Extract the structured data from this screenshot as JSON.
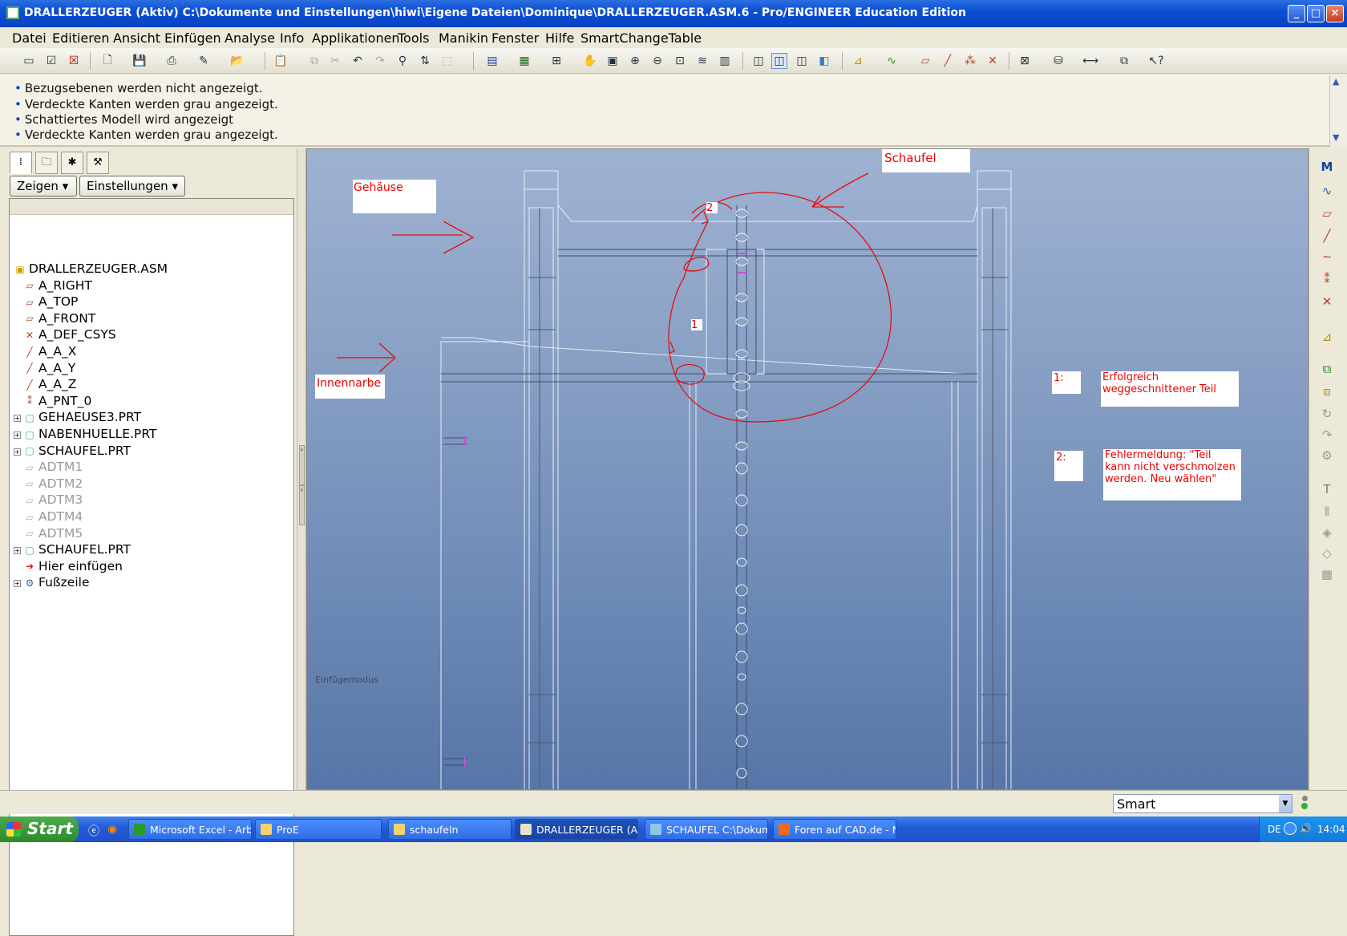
{
  "window": {
    "title": "DRALLERZEUGER (Aktiv) C:\\Dokumente und Einstellungen\\hiwi\\Eigene Dateien\\Dominique\\DRALLERZEUGER.ASM.6 - Pro/ENGINEER Education Edition",
    "minimize": "_",
    "maximize": "□",
    "close": "×"
  },
  "menu": [
    "Datei",
    "Editieren",
    "Ansicht",
    "Einfügen",
    "Analyse",
    "Info",
    "Applikationen",
    "Tools",
    "Manikin",
    "Fenster",
    "Hilfe",
    "SmartChangeTable"
  ],
  "messages": [
    "Bezugsebenen werden nicht angezeigt.",
    "Verdeckte Kanten werden grau angezeigt.",
    "Schattiertes Modell wird angezeigt",
    "Verdeckte Kanten werden grau angezeigt."
  ],
  "leftpanel": {
    "show_label": "Zeigen",
    "settings_label": "Einstellungen",
    "tree": [
      {
        "label": "DRALLERZEUGER.ASM",
        "icon": "assembly-icon",
        "disabled": false
      },
      {
        "label": "A_RIGHT",
        "icon": "datum-plane-icon",
        "disabled": false
      },
      {
        "label": "A_TOP",
        "icon": "datum-plane-icon",
        "disabled": false
      },
      {
        "label": "A_FRONT",
        "icon": "datum-plane-icon",
        "disabled": false
      },
      {
        "label": "A_DEF_CSYS",
        "icon": "csys-icon",
        "disabled": false
      },
      {
        "label": "A_A_X",
        "icon": "axis-icon",
        "disabled": false
      },
      {
        "label": "A_A_Y",
        "icon": "axis-icon",
        "disabled": false
      },
      {
        "label": "A_A_Z",
        "icon": "axis-icon",
        "disabled": false
      },
      {
        "label": "A_PNT_0",
        "icon": "point-icon",
        "disabled": false
      },
      {
        "label": "GEHAEUSE3.PRT",
        "icon": "part-icon",
        "disabled": false
      },
      {
        "label": "NABENHUELLE.PRT",
        "icon": "part-icon",
        "disabled": false
      },
      {
        "label": "SCHAUFEL.PRT",
        "icon": "part-icon",
        "disabled": false
      },
      {
        "label": "ADTM1",
        "icon": "datum-plane-icon",
        "disabled": true
      },
      {
        "label": "ADTM2",
        "icon": "datum-plane-icon",
        "disabled": true
      },
      {
        "label": "ADTM3",
        "icon": "datum-plane-icon",
        "disabled": true
      },
      {
        "label": "ADTM4",
        "icon": "datum-plane-icon",
        "disabled": true
      },
      {
        "label": "ADTM5",
        "icon": "datum-plane-icon",
        "disabled": true
      },
      {
        "label": "SCHAUFEL.PRT",
        "icon": "part-icon",
        "disabled": false
      },
      {
        "label": "Hier einfügen",
        "icon": "insert-arrow-icon",
        "disabled": false
      },
      {
        "label": "Fußzeile",
        "icon": "footer-icon",
        "disabled": false
      }
    ]
  },
  "viewport": {
    "annotations": {
      "gehaeuse": "Gehäuse",
      "schaufel": "Schaufel",
      "innennarbe": "Innennarbe",
      "marker1": "1",
      "marker2": "2",
      "note1_num": "1:",
      "note1_text": "Erfolgreich weggeschnittener Teil",
      "note2_num": "2:",
      "note2_text": "Fehlermeldung: \"Teil kann nicht verschmolzen werden. Neu wählen\""
    },
    "mode_text": "Einfügemodus"
  },
  "status": {
    "filter": "Smart"
  },
  "taskbar": {
    "start": "Start",
    "tasks": [
      {
        "label": "Microsoft Excel - Arb...",
        "active": false
      },
      {
        "label": "ProE",
        "active": false
      },
      {
        "label": "schaufeln",
        "active": false
      },
      {
        "label": "DRALLERZEUGER (Ak...",
        "active": true
      },
      {
        "label": "SCHAUFEL C:\\Dokum...",
        "active": false
      },
      {
        "label": "Foren auf CAD.de - N...",
        "active": false
      }
    ],
    "lang": "DE",
    "clock": "14:04"
  },
  "colors": {
    "accent": "#0b4fd6",
    "annotation": "#e00000",
    "viewport_top": "#9fb2d2",
    "viewport_bottom": "#5775a6"
  }
}
